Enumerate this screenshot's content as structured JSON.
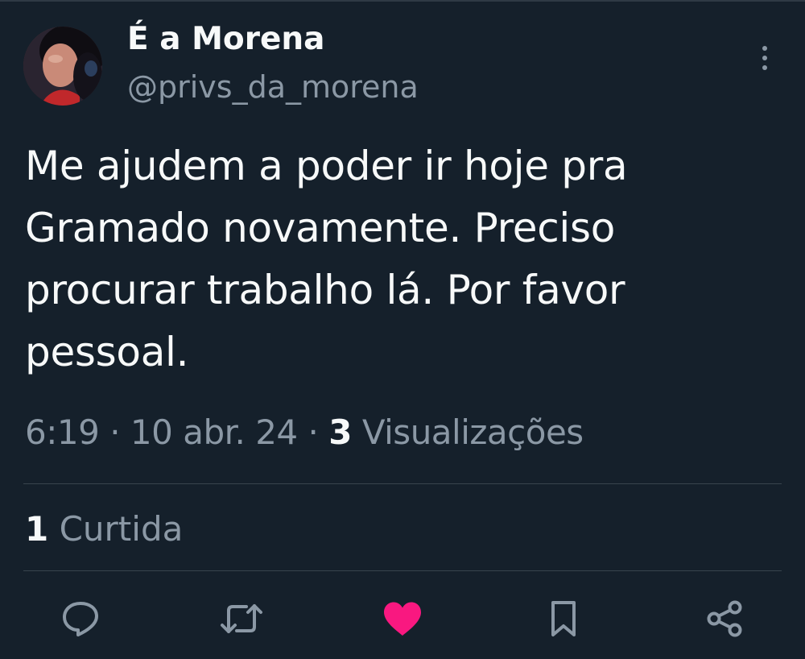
{
  "author": {
    "display_name": "É a Morena",
    "handle": "@privs_da_morena"
  },
  "tweet": {
    "text": "Me ajudem a poder ir hoje pra\nGramado novamente. Preciso\nprocurar trabalho lá. Por favor\npessoal."
  },
  "meta": {
    "time": "6:19",
    "separator": "·",
    "date": "10 abr. 24",
    "views_count": "3",
    "views_label": "Visualizações"
  },
  "stats": {
    "likes_count": "1",
    "likes_label": "Curtida"
  },
  "actions": {
    "reply_icon": "reply-icon",
    "retweet_icon": "retweet-icon",
    "like_icon": "heart-icon",
    "bookmark_icon": "bookmark-icon",
    "share_icon": "share-icon",
    "liked": true
  },
  "colors": {
    "background": "#15202b",
    "primary_text": "#f7f9f9",
    "secondary_text": "#8b98a5",
    "divider": "#38444d",
    "like_pink": "#f91880"
  }
}
